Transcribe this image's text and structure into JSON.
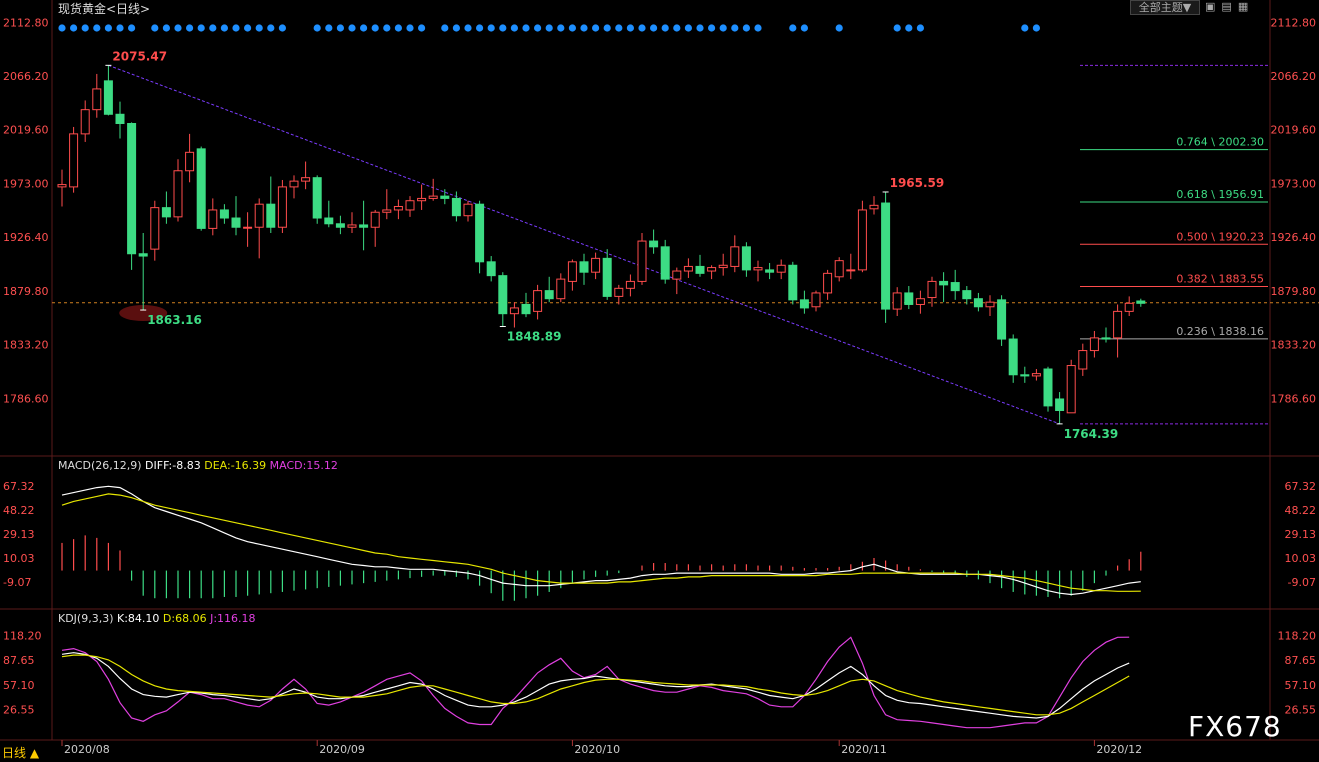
{
  "window": {
    "title": "现货黄金<日线>",
    "theme_button": "全部主题▼",
    "period_label": "日线 ▲",
    "watermark": "FX678"
  },
  "indicators": {
    "macd": {
      "name": "MACD(26,12,9)",
      "diff": "DIFF:-8.83",
      "dea": "DEA:-16.39",
      "macd": "MACD:15.12"
    },
    "kdj": {
      "name": "KDJ(9,3,3)",
      "k": "K:84.10",
      "d": "D:68.06",
      "j": "J:116.18"
    }
  },
  "colors": {
    "up": "#ff4d4d",
    "down": "#3ddc84",
    "diff": "#ffffff",
    "dea": "#e6e600",
    "j": "#e040e0",
    "dots": "#1e8fff"
  },
  "chart_data": {
    "type": "candlestick",
    "x_ticks": [
      "2020/08",
      "2020/09",
      "2020/10",
      "2020/11",
      "2020/12"
    ],
    "price_axis": {
      "ylim": [
        1740,
        2120
      ],
      "ticks": [
        "2112.80",
        "2066.20",
        "2019.60",
        "1973.00",
        "1926.40",
        "1879.80",
        "1833.20",
        "1786.60"
      ]
    },
    "macd_axis": {
      "ylim": [
        -25,
        80
      ],
      "ticks": [
        "67.32",
        "48.22",
        "29.13",
        "10.03",
        "-9.07"
      ]
    },
    "kdj_axis": {
      "ylim": [
        -5,
        135
      ],
      "ticks": [
        "118.20",
        "87.65",
        "57.10",
        "26.55"
      ]
    },
    "annotations": [
      {
        "label": "2075.47",
        "value": 2075.47,
        "color": "#ff4d4d"
      },
      {
        "label": "1863.16",
        "value": 1863.16,
        "color": "#3ddc84"
      },
      {
        "label": "1848.89",
        "value": 1848.89,
        "color": "#3ddc84"
      },
      {
        "label": "1965.59",
        "value": 1965.59,
        "color": "#ff4d4d"
      },
      {
        "label": "1764.39",
        "value": 1764.39,
        "color": "#3ddc84"
      }
    ],
    "fib_levels": [
      {
        "label": "0.764 \\ 2002.30",
        "value": 2002.3,
        "color": "#3ddc84"
      },
      {
        "label": "0.618 \\ 1956.91",
        "value": 1956.91,
        "color": "#3ddc84"
      },
      {
        "label": "0.500 \\ 1920.23",
        "value": 1920.23,
        "color": "#ff4d4d"
      },
      {
        "label": "0.382 \\ 1883.55",
        "value": 1883.55,
        "color": "#ff4d4d"
      },
      {
        "label": "0.236 \\ 1838.16",
        "value": 1838.16,
        "color": "#aaaaaa"
      }
    ],
    "fib_bounds": [
      2075.47,
      1764.39
    ],
    "current_price": 1869.5,
    "candles": [
      {
        "o": 1970,
        "h": 1985,
        "l": 1953,
        "c": 1972
      },
      {
        "o": 1970,
        "h": 2022,
        "l": 1965,
        "c": 2016
      },
      {
        "o": 2016,
        "h": 2045,
        "l": 2009,
        "c": 2037
      },
      {
        "o": 2037,
        "h": 2068,
        "l": 2030,
        "c": 2055
      },
      {
        "o": 2062,
        "h": 2075.47,
        "l": 2032,
        "c": 2033
      },
      {
        "o": 2033,
        "h": 2044,
        "l": 2012,
        "c": 2025
      },
      {
        "o": 2025,
        "h": 2026,
        "l": 1898,
        "c": 1912
      },
      {
        "o": 1912,
        "h": 1930,
        "l": 1863.16,
        "c": 1910
      },
      {
        "o": 1916,
        "h": 1958,
        "l": 1906,
        "c": 1952
      },
      {
        "o": 1952,
        "h": 1966,
        "l": 1938,
        "c": 1944
      },
      {
        "o": 1944,
        "h": 1994,
        "l": 1940,
        "c": 1984
      },
      {
        "o": 1984,
        "h": 2016,
        "l": 1974,
        "c": 2000
      },
      {
        "o": 2003,
        "h": 2005,
        "l": 1932,
        "c": 1934
      },
      {
        "o": 1934,
        "h": 1960,
        "l": 1928,
        "c": 1950
      },
      {
        "o": 1950,
        "h": 1955,
        "l": 1938,
        "c": 1943
      },
      {
        "o": 1943,
        "h": 1962,
        "l": 1928,
        "c": 1935
      },
      {
        "o": 1935,
        "h": 1948,
        "l": 1918,
        "c": 1935
      },
      {
        "o": 1935,
        "h": 1960,
        "l": 1908,
        "c": 1955
      },
      {
        "o": 1955,
        "h": 1979,
        "l": 1930,
        "c": 1935
      },
      {
        "o": 1935,
        "h": 1976,
        "l": 1930,
        "c": 1970
      },
      {
        "o": 1970,
        "h": 1980,
        "l": 1960,
        "c": 1975
      },
      {
        "o": 1975,
        "h": 1992,
        "l": 1968,
        "c": 1978
      },
      {
        "o": 1978,
        "h": 1980,
        "l": 1938,
        "c": 1943
      },
      {
        "o": 1943,
        "h": 1958,
        "l": 1935,
        "c": 1938
      },
      {
        "o": 1938,
        "h": 1945,
        "l": 1929,
        "c": 1935
      },
      {
        "o": 1935,
        "h": 1948,
        "l": 1930,
        "c": 1937
      },
      {
        "o": 1937,
        "h": 1958,
        "l": 1915,
        "c": 1935
      },
      {
        "o": 1935,
        "h": 1950,
        "l": 1918,
        "c": 1948
      },
      {
        "o": 1948,
        "h": 1968,
        "l": 1942,
        "c": 1950
      },
      {
        "o": 1950,
        "h": 1959,
        "l": 1942,
        "c": 1953
      },
      {
        "o": 1950,
        "h": 1962,
        "l": 1944,
        "c": 1958
      },
      {
        "o": 1958,
        "h": 1972,
        "l": 1950,
        "c": 1960
      },
      {
        "o": 1960,
        "h": 1977,
        "l": 1958,
        "c": 1962
      },
      {
        "o": 1962,
        "h": 1968,
        "l": 1955,
        "c": 1960
      },
      {
        "o": 1960,
        "h": 1966,
        "l": 1940,
        "c": 1945
      },
      {
        "o": 1945,
        "h": 1958,
        "l": 1940,
        "c": 1955
      },
      {
        "o": 1955,
        "h": 1958,
        "l": 1895,
        "c": 1905
      },
      {
        "o": 1905,
        "h": 1910,
        "l": 1888,
        "c": 1893
      },
      {
        "o": 1893,
        "h": 1896,
        "l": 1848.89,
        "c": 1860
      },
      {
        "o": 1860,
        "h": 1870,
        "l": 1848,
        "c": 1865
      },
      {
        "o": 1868,
        "h": 1878,
        "l": 1857,
        "c": 1860
      },
      {
        "o": 1862,
        "h": 1885,
        "l": 1855,
        "c": 1880
      },
      {
        "o": 1880,
        "h": 1892,
        "l": 1870,
        "c": 1873
      },
      {
        "o": 1873,
        "h": 1895,
        "l": 1870,
        "c": 1890
      },
      {
        "o": 1888,
        "h": 1907,
        "l": 1880,
        "c": 1905
      },
      {
        "o": 1905,
        "h": 1912,
        "l": 1885,
        "c": 1896
      },
      {
        "o": 1896,
        "h": 1913,
        "l": 1890,
        "c": 1908
      },
      {
        "o": 1908,
        "h": 1916,
        "l": 1872,
        "c": 1875
      },
      {
        "o": 1875,
        "h": 1885,
        "l": 1868,
        "c": 1882
      },
      {
        "o": 1882,
        "h": 1894,
        "l": 1875,
        "c": 1888
      },
      {
        "o": 1888,
        "h": 1930,
        "l": 1885,
        "c": 1923
      },
      {
        "o": 1923,
        "h": 1933,
        "l": 1912,
        "c": 1918
      },
      {
        "o": 1918,
        "h": 1924,
        "l": 1886,
        "c": 1890
      },
      {
        "o": 1890,
        "h": 1900,
        "l": 1877,
        "c": 1897
      },
      {
        "o": 1897,
        "h": 1908,
        "l": 1891,
        "c": 1901
      },
      {
        "o": 1901,
        "h": 1911,
        "l": 1892,
        "c": 1895
      },
      {
        "o": 1897,
        "h": 1902,
        "l": 1890,
        "c": 1900
      },
      {
        "o": 1900,
        "h": 1912,
        "l": 1893,
        "c": 1902
      },
      {
        "o": 1901,
        "h": 1928,
        "l": 1896,
        "c": 1918
      },
      {
        "o": 1918,
        "h": 1922,
        "l": 1892,
        "c": 1898
      },
      {
        "o": 1898,
        "h": 1906,
        "l": 1888,
        "c": 1900
      },
      {
        "o": 1898,
        "h": 1904,
        "l": 1890,
        "c": 1896
      },
      {
        "o": 1896,
        "h": 1907,
        "l": 1890,
        "c": 1902
      },
      {
        "o": 1902,
        "h": 1905,
        "l": 1868,
        "c": 1872
      },
      {
        "o": 1872,
        "h": 1880,
        "l": 1860,
        "c": 1865
      },
      {
        "o": 1866,
        "h": 1880,
        "l": 1862,
        "c": 1878
      },
      {
        "o": 1878,
        "h": 1898,
        "l": 1872,
        "c": 1895
      },
      {
        "o": 1892,
        "h": 1909,
        "l": 1888,
        "c": 1906
      },
      {
        "o": 1898,
        "h": 1912,
        "l": 1890,
        "c": 1898
      },
      {
        "o": 1898,
        "h": 1958,
        "l": 1896,
        "c": 1950
      },
      {
        "o": 1951,
        "h": 1962,
        "l": 1946,
        "c": 1954
      },
      {
        "o": 1956,
        "h": 1965.59,
        "l": 1852,
        "c": 1864
      },
      {
        "o": 1864,
        "h": 1883,
        "l": 1858,
        "c": 1878
      },
      {
        "o": 1878,
        "h": 1884,
        "l": 1864,
        "c": 1868
      },
      {
        "o": 1868,
        "h": 1880,
        "l": 1860,
        "c": 1873
      },
      {
        "o": 1874,
        "h": 1892,
        "l": 1866,
        "c": 1888
      },
      {
        "o": 1888,
        "h": 1896,
        "l": 1870,
        "c": 1885
      },
      {
        "o": 1887,
        "h": 1898,
        "l": 1872,
        "c": 1880
      },
      {
        "o": 1880,
        "h": 1884,
        "l": 1868,
        "c": 1873
      },
      {
        "o": 1873,
        "h": 1878,
        "l": 1862,
        "c": 1866
      },
      {
        "o": 1866,
        "h": 1876,
        "l": 1858,
        "c": 1870
      },
      {
        "o": 1872,
        "h": 1876,
        "l": 1832,
        "c": 1838
      },
      {
        "o": 1838,
        "h": 1842,
        "l": 1800,
        "c": 1807
      },
      {
        "o": 1807,
        "h": 1814,
        "l": 1800,
        "c": 1806
      },
      {
        "o": 1806,
        "h": 1812,
        "l": 1802,
        "c": 1808
      },
      {
        "o": 1812,
        "h": 1814,
        "l": 1775,
        "c": 1780
      },
      {
        "o": 1786,
        "h": 1792,
        "l": 1764.39,
        "c": 1776
      },
      {
        "o": 1774,
        "h": 1820,
        "l": 1774,
        "c": 1815
      },
      {
        "o": 1812,
        "h": 1834,
        "l": 1806,
        "c": 1828
      },
      {
        "o": 1828,
        "h": 1845,
        "l": 1822,
        "c": 1839
      },
      {
        "o": 1839,
        "h": 1848,
        "l": 1835,
        "c": 1838
      },
      {
        "o": 1839,
        "h": 1868,
        "l": 1822,
        "c": 1862
      },
      {
        "o": 1862,
        "h": 1875,
        "l": 1858,
        "c": 1869
      },
      {
        "o": 1871,
        "h": 1873,
        "l": 1866,
        "c": 1869
      }
    ],
    "macd_bars": [
      22,
      25,
      28,
      26,
      22,
      16,
      -8,
      -20,
      -22,
      -22,
      -22,
      -22,
      -22,
      -22,
      -21,
      -21,
      -20,
      -19,
      -18,
      -17,
      -16,
      -15,
      -14,
      -13,
      -12,
      -11,
      -10,
      -9,
      -8,
      -7,
      -6,
      -5,
      -4,
      -4,
      -5,
      -7,
      -12,
      -18,
      -24,
      -24,
      -22,
      -20,
      -17,
      -14,
      -10,
      -7,
      -5,
      -4,
      -2,
      0,
      4,
      6,
      6,
      5,
      5,
      4,
      5,
      4,
      5,
      5,
      4,
      4,
      4,
      3,
      2,
      2,
      2,
      3,
      5,
      7,
      10,
      8,
      5,
      3,
      1,
      -1,
      -2,
      -3,
      -5,
      -7,
      -10,
      -14,
      -17,
      -19,
      -20,
      -21,
      -22,
      -20,
      -16,
      -10,
      -4,
      4,
      9,
      15
    ],
    "macd_diff": [
      60,
      62,
      64,
      66,
      67,
      66,
      61,
      55,
      50,
      47,
      44,
      41,
      38,
      34,
      30,
      26,
      23,
      21,
      19,
      17,
      15,
      13,
      11,
      9,
      7,
      5,
      4,
      3,
      3,
      2,
      1,
      1,
      1,
      0,
      -1,
      -2,
      -4,
      -7,
      -10,
      -11,
      -12,
      -12,
      -12,
      -11,
      -10,
      -9,
      -8,
      -8,
      -7,
      -6,
      -4,
      -3,
      -3,
      -2,
      -2,
      -2,
      -2,
      -2,
      -2,
      -2,
      -2,
      -2,
      -3,
      -3,
      -3,
      -2,
      -2,
      -1,
      0,
      3,
      5,
      2,
      -1,
      -2,
      -3,
      -3,
      -3,
      -3,
      -3,
      -3,
      -4,
      -5,
      -7,
      -10,
      -13,
      -16,
      -18,
      -19,
      -18,
      -16,
      -14,
      -12,
      -10,
      -8.83
    ],
    "macd_dea": [
      52,
      55,
      57,
      59,
      61,
      60,
      58,
      55,
      52,
      50,
      48,
      46,
      44,
      42,
      40,
      38,
      36,
      34,
      32,
      30,
      28,
      26,
      24,
      22,
      20,
      18,
      16,
      14,
      13,
      11,
      10,
      9,
      8,
      7,
      6,
      5,
      3,
      1,
      -2,
      -4,
      -6,
      -8,
      -9,
      -10,
      -10,
      -10,
      -10,
      -10,
      -9,
      -9,
      -8,
      -7,
      -6,
      -6,
      -5,
      -5,
      -4,
      -4,
      -4,
      -4,
      -4,
      -4,
      -4,
      -4,
      -4,
      -4,
      -3,
      -3,
      -3,
      -2,
      -2,
      -2,
      -2,
      -2,
      -2,
      -2,
      -2,
      -2,
      -3,
      -3,
      -3,
      -4,
      -5,
      -6,
      -8,
      -10,
      -12,
      -14,
      -15,
      -16,
      -16,
      -16.5,
      -16.5,
      -16.39
    ],
    "kdj_k": [
      95,
      97,
      95,
      90,
      80,
      65,
      52,
      45,
      43,
      42,
      45,
      48,
      47,
      45,
      44,
      42,
      40,
      38,
      40,
      46,
      52,
      48,
      42,
      40,
      40,
      42,
      44,
      48,
      52,
      56,
      60,
      58,
      52,
      44,
      38,
      32,
      30,
      30,
      32,
      36,
      42,
      50,
      58,
      62,
      64,
      65,
      68,
      66,
      64,
      62,
      60,
      58,
      56,
      55,
      55,
      57,
      58,
      56,
      54,
      52,
      48,
      44,
      42,
      40,
      44,
      52,
      62,
      72,
      80,
      70,
      56,
      44,
      38,
      35,
      34,
      32,
      30,
      28,
      26,
      24,
      22,
      20,
      18,
      17,
      16,
      18,
      28,
      40,
      52,
      62,
      70,
      78,
      84.1
    ],
    "kdj_d": [
      92,
      94,
      94,
      92,
      88,
      80,
      70,
      62,
      56,
      52,
      50,
      49,
      48,
      47,
      46,
      45,
      44,
      43,
      42,
      44,
      46,
      47,
      46,
      44,
      42,
      42,
      42,
      44,
      46,
      50,
      54,
      56,
      56,
      52,
      48,
      44,
      40,
      36,
      34,
      34,
      36,
      40,
      46,
      52,
      56,
      60,
      63,
      64,
      64,
      63,
      62,
      60,
      59,
      58,
      57,
      57,
      57,
      57,
      56,
      55,
      52,
      50,
      47,
      45,
      44,
      46,
      50,
      56,
      62,
      64,
      62,
      56,
      50,
      46,
      42,
      39,
      36,
      34,
      32,
      30,
      28,
      26,
      24,
      22,
      20,
      20,
      22,
      28,
      36,
      44,
      52,
      60,
      68.06
    ],
    "kdj_j": [
      100,
      102,
      97,
      86,
      64,
      35,
      16,
      12,
      20,
      25,
      36,
      48,
      45,
      40,
      40,
      36,
      32,
      30,
      38,
      52,
      64,
      52,
      34,
      32,
      36,
      42,
      48,
      56,
      64,
      68,
      72,
      62,
      44,
      28,
      18,
      10,
      8,
      8,
      28,
      40,
      56,
      72,
      82,
      90,
      74,
      66,
      70,
      80,
      64,
      58,
      54,
      50,
      48,
      48,
      52,
      56,
      54,
      50,
      48,
      46,
      40,
      32,
      30,
      30,
      44,
      64,
      86,
      104,
      116,
      84,
      44,
      20,
      14,
      13,
      12,
      10,
      8,
      6,
      4,
      4,
      4,
      6,
      8,
      10,
      10,
      18,
      42,
      66,
      86,
      100,
      110,
      116,
      116.18
    ],
    "signal_dots_columns": [
      0,
      1,
      2,
      3,
      4,
      5,
      6,
      8,
      9,
      10,
      11,
      12,
      13,
      14,
      15,
      16,
      17,
      18,
      19,
      22,
      23,
      24,
      25,
      26,
      27,
      28,
      29,
      30,
      31,
      33,
      34,
      35,
      36,
      37,
      38,
      39,
      40,
      41,
      42,
      43,
      44,
      45,
      46,
      47,
      48,
      49,
      50,
      51,
      52,
      53,
      54,
      55,
      56,
      57,
      58,
      59,
      60,
      63,
      64,
      67,
      72,
      73,
      74,
      83,
      84
    ]
  }
}
